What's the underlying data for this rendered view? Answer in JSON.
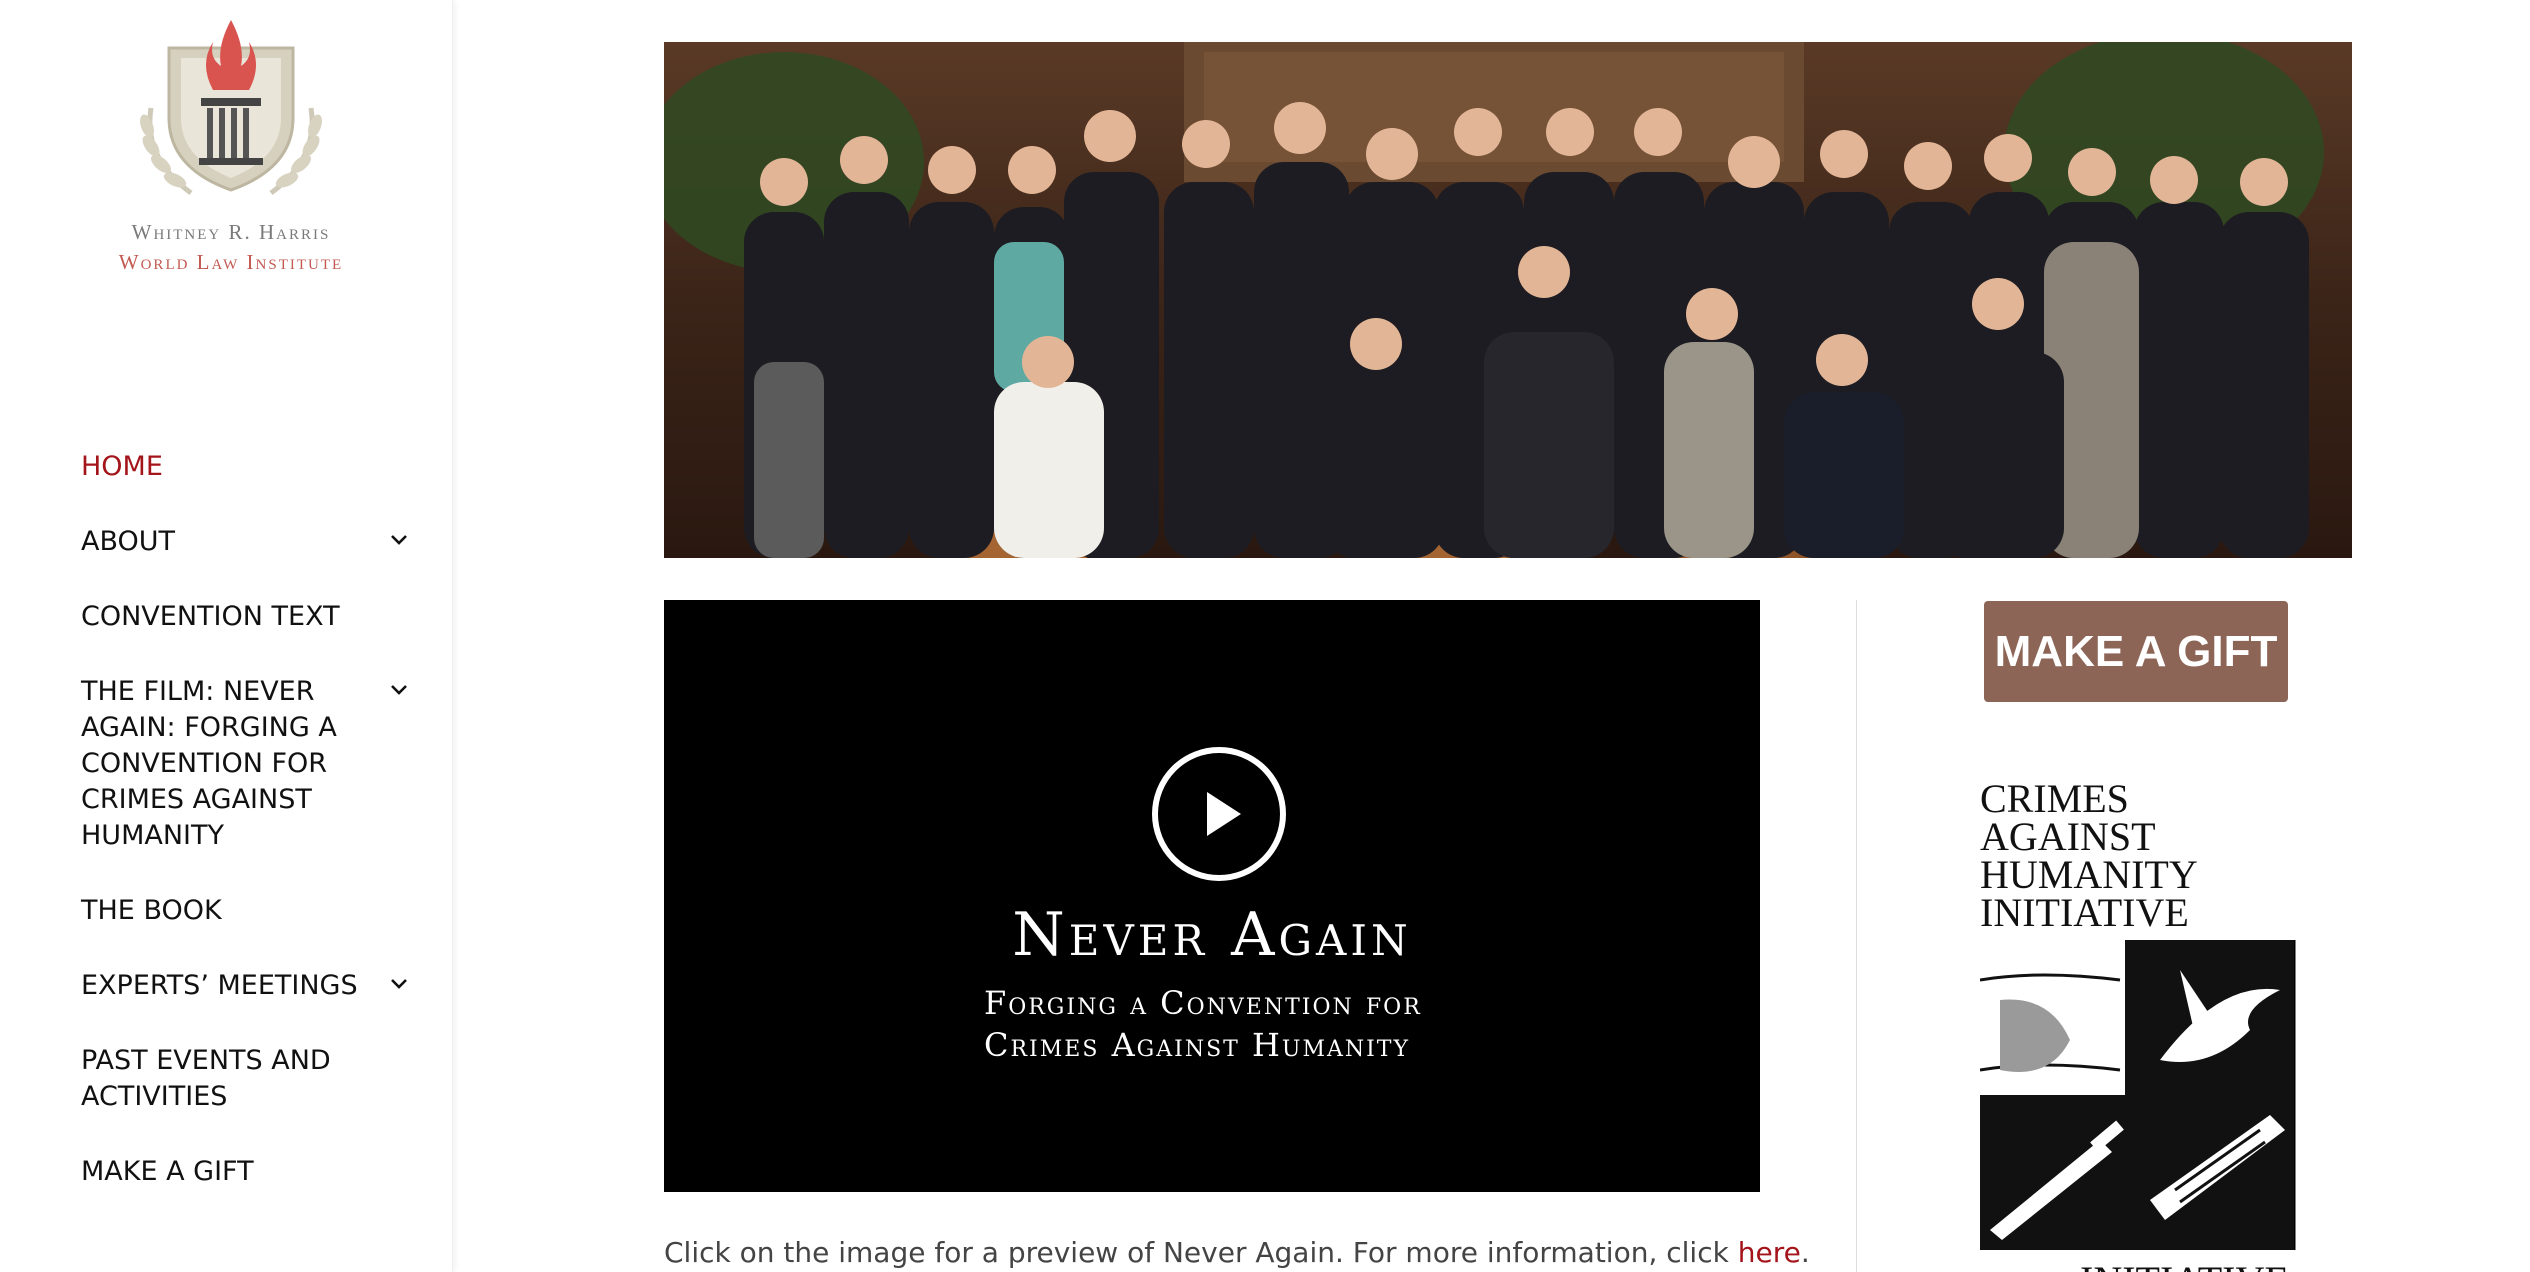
{
  "logo": {
    "line1": "Whitney R. Harris",
    "line2": "World Law Institute",
    "colors": {
      "flame": "#d9534f",
      "shield": "#c8c4b4",
      "gray": "#7a7a7a",
      "red": "#c25a52"
    }
  },
  "nav": {
    "items": [
      {
        "label": "HOME",
        "active": true,
        "has_submenu": false
      },
      {
        "label": "ABOUT",
        "active": false,
        "has_submenu": true
      },
      {
        "label": "CONVENTION TEXT",
        "active": false,
        "has_submenu": false
      },
      {
        "label": "THE FILM: NEVER AGAIN: FORGING A CONVENTION FOR CRIMES AGAINST HUMANITY",
        "active": false,
        "has_submenu": true
      },
      {
        "label": "THE BOOK",
        "active": false,
        "has_submenu": false
      },
      {
        "label": "EXPERTS’ MEETINGS",
        "active": false,
        "has_submenu": true
      },
      {
        "label": "PAST EVENTS AND ACTIVITIES",
        "active": false,
        "has_submenu": false
      },
      {
        "label": "MAKE A GIFT",
        "active": false,
        "has_submenu": false
      }
    ],
    "active_color": "#a4151b"
  },
  "hero": {
    "image": "group-photo"
  },
  "video": {
    "title": "Never Again",
    "subtitle_line1": "Forging a Convention for",
    "subtitle_line2": "Crimes Against Humanity",
    "icon": "play-icon"
  },
  "caption": {
    "text_before": "Click on the image for a preview of Never Again. For more information, click ",
    "link_text": "here",
    "text_after": "."
  },
  "sidebar_right": {
    "gift_button": "MAKE A GIFT",
    "gift_color": "#8c6556",
    "cahi_lines": [
      "CRIMES",
      "AGAINST",
      "HUMANITY",
      "INITIATIVE"
    ],
    "cahi_bottom": "INITIATIVE"
  }
}
